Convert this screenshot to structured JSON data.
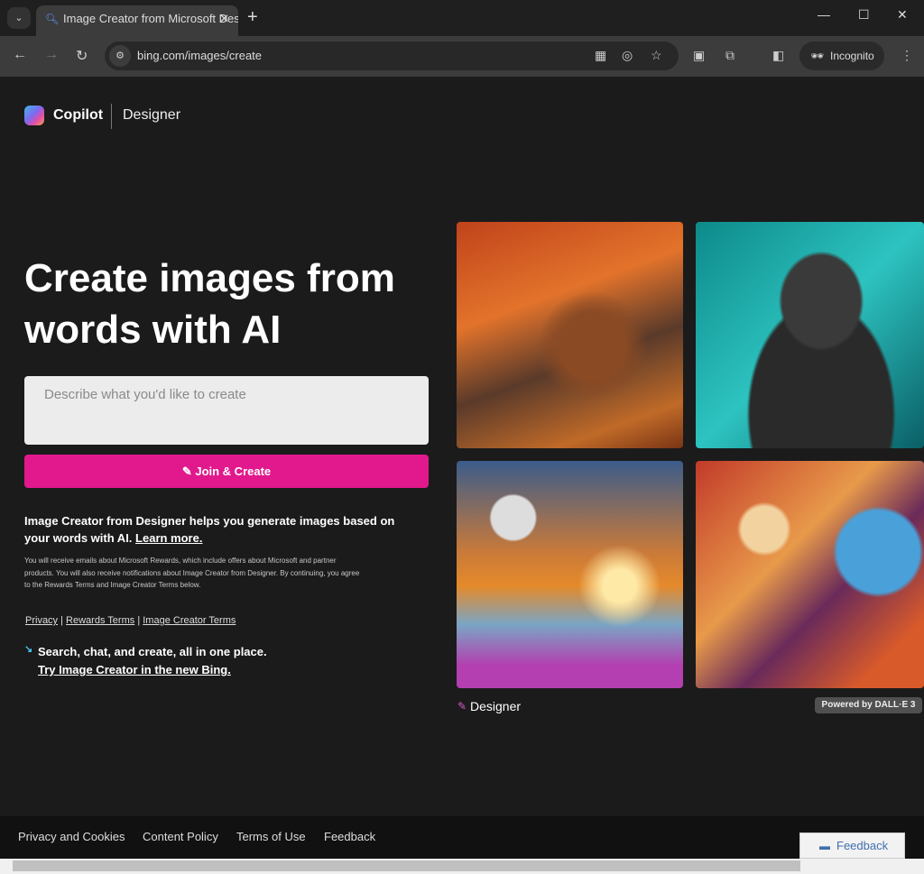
{
  "browser": {
    "tab_title": "Image Creator from Microsoft Designer",
    "url": "bing.com/images/create",
    "incognito_label": "Incognito"
  },
  "header": {
    "brand": "Copilot",
    "product": "Designer"
  },
  "hero": {
    "title": "Create images from words with AI",
    "prompt_placeholder": "Describe what you'd like to create",
    "join_button": "Join & Create"
  },
  "intro": {
    "text": "Image Creator from Designer helps you generate images based on your words with AI.",
    "learn_more": "Learn more.",
    "fine_print": "You will receive emails about Microsoft Rewards, which include offers about Microsoft and partner products. You will also receive notifications about Image Creator from Designer. By continuing, you agree to the Rewards Terms and Image Creator Terms below."
  },
  "links": {
    "privacy": "Privacy",
    "rewards_terms": "Rewards Terms",
    "creator_terms": "Image Creator Terms",
    "sep": "|"
  },
  "promo": {
    "line1": "Search, chat, and create, all in one place.",
    "line2": "Try Image Creator in the new Bing."
  },
  "gallery": {
    "designer_label": "Designer",
    "powered_by": "Powered by DALL·E 3"
  },
  "footer": {
    "items": [
      "Privacy and Cookies",
      "Content Policy",
      "Terms of Use",
      "Feedback"
    ],
    "feedback_button": "Feedback"
  }
}
